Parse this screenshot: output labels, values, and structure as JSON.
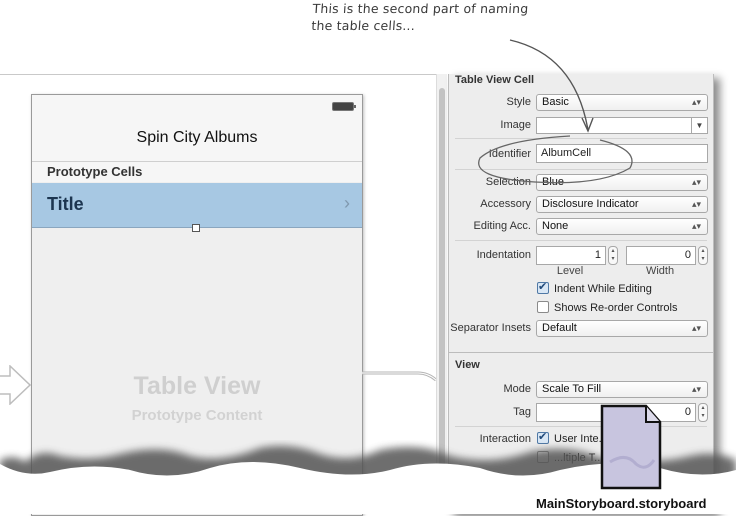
{
  "annotation": {
    "line1": "This is the second part of naming",
    "line2": "the table cells..."
  },
  "canvas": {
    "nav_title": "Spin City Albums",
    "section_header": "Prototype Cells",
    "cell_title": "Title",
    "cell_accessory_icon": "chevron-right",
    "placeholder_title": "Table View",
    "placeholder_subtitle": "Prototype Content"
  },
  "inspector": {
    "table_view_cell": {
      "section_title": "Table View Cell",
      "style": {
        "label": "Style",
        "value": "Basic"
      },
      "image": {
        "label": "Image",
        "value": ""
      },
      "identifier": {
        "label": "Identifier",
        "value": "AlbumCell"
      },
      "selection": {
        "label": "Selection",
        "value": "Blue"
      },
      "accessory": {
        "label": "Accessory",
        "value": "Disclosure Indicator"
      },
      "editing_acc": {
        "label": "Editing Acc.",
        "value": "None"
      },
      "indentation": {
        "label": "Indentation",
        "level_value": "1",
        "level_label": "Level",
        "width_value": "0",
        "width_label": "Width"
      },
      "indent_while_editing": {
        "label": "Indent While Editing",
        "checked": true
      },
      "shows_reorder": {
        "label": "Shows Re-order Controls",
        "checked": false
      },
      "separator_insets": {
        "label": "Separator Insets",
        "value": "Default"
      }
    },
    "view": {
      "section_title": "View",
      "mode": {
        "label": "Mode",
        "value": "Scale To Fill"
      },
      "tag": {
        "label": "Tag",
        "value": "0"
      },
      "interaction": {
        "label": "Interaction",
        "user_interaction": "User Inte...bled",
        "multiple_touch": "...ltiple T..."
      }
    }
  },
  "file": {
    "name": "MainStoryboard.storyboard",
    "icon": "document-icon"
  },
  "colors": {
    "cell_selected": "#a7c8e3",
    "inspector_bg": "#ededed"
  }
}
